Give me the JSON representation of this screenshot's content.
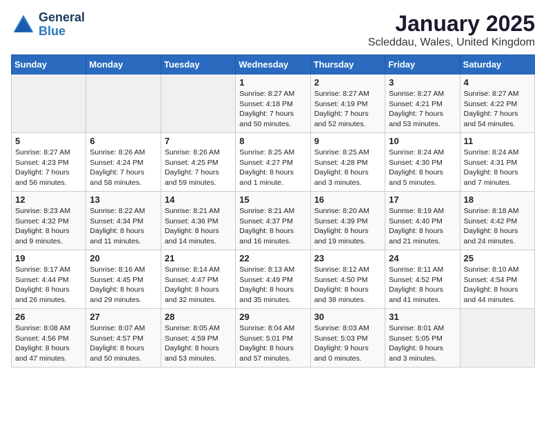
{
  "logo": {
    "line1": "General",
    "line2": "Blue"
  },
  "title": "January 2025",
  "location": "Scleddau, Wales, United Kingdom",
  "days_header": [
    "Sunday",
    "Monday",
    "Tuesday",
    "Wednesday",
    "Thursday",
    "Friday",
    "Saturday"
  ],
  "weeks": [
    [
      {
        "day": "",
        "text": ""
      },
      {
        "day": "",
        "text": ""
      },
      {
        "day": "",
        "text": ""
      },
      {
        "day": "1",
        "text": "Sunrise: 8:27 AM\nSunset: 4:18 PM\nDaylight: 7 hours\nand 50 minutes."
      },
      {
        "day": "2",
        "text": "Sunrise: 8:27 AM\nSunset: 4:19 PM\nDaylight: 7 hours\nand 52 minutes."
      },
      {
        "day": "3",
        "text": "Sunrise: 8:27 AM\nSunset: 4:21 PM\nDaylight: 7 hours\nand 53 minutes."
      },
      {
        "day": "4",
        "text": "Sunrise: 8:27 AM\nSunset: 4:22 PM\nDaylight: 7 hours\nand 54 minutes."
      }
    ],
    [
      {
        "day": "5",
        "text": "Sunrise: 8:27 AM\nSunset: 4:23 PM\nDaylight: 7 hours\nand 56 minutes."
      },
      {
        "day": "6",
        "text": "Sunrise: 8:26 AM\nSunset: 4:24 PM\nDaylight: 7 hours\nand 58 minutes."
      },
      {
        "day": "7",
        "text": "Sunrise: 8:26 AM\nSunset: 4:25 PM\nDaylight: 7 hours\nand 59 minutes."
      },
      {
        "day": "8",
        "text": "Sunrise: 8:25 AM\nSunset: 4:27 PM\nDaylight: 8 hours\nand 1 minute."
      },
      {
        "day": "9",
        "text": "Sunrise: 8:25 AM\nSunset: 4:28 PM\nDaylight: 8 hours\nand 3 minutes."
      },
      {
        "day": "10",
        "text": "Sunrise: 8:24 AM\nSunset: 4:30 PM\nDaylight: 8 hours\nand 5 minutes."
      },
      {
        "day": "11",
        "text": "Sunrise: 8:24 AM\nSunset: 4:31 PM\nDaylight: 8 hours\nand 7 minutes."
      }
    ],
    [
      {
        "day": "12",
        "text": "Sunrise: 8:23 AM\nSunset: 4:32 PM\nDaylight: 8 hours\nand 9 minutes."
      },
      {
        "day": "13",
        "text": "Sunrise: 8:22 AM\nSunset: 4:34 PM\nDaylight: 8 hours\nand 11 minutes."
      },
      {
        "day": "14",
        "text": "Sunrise: 8:21 AM\nSunset: 4:36 PM\nDaylight: 8 hours\nand 14 minutes."
      },
      {
        "day": "15",
        "text": "Sunrise: 8:21 AM\nSunset: 4:37 PM\nDaylight: 8 hours\nand 16 minutes."
      },
      {
        "day": "16",
        "text": "Sunrise: 8:20 AM\nSunset: 4:39 PM\nDaylight: 8 hours\nand 19 minutes."
      },
      {
        "day": "17",
        "text": "Sunrise: 8:19 AM\nSunset: 4:40 PM\nDaylight: 8 hours\nand 21 minutes."
      },
      {
        "day": "18",
        "text": "Sunrise: 8:18 AM\nSunset: 4:42 PM\nDaylight: 8 hours\nand 24 minutes."
      }
    ],
    [
      {
        "day": "19",
        "text": "Sunrise: 8:17 AM\nSunset: 4:44 PM\nDaylight: 8 hours\nand 26 minutes."
      },
      {
        "day": "20",
        "text": "Sunrise: 8:16 AM\nSunset: 4:45 PM\nDaylight: 8 hours\nand 29 minutes."
      },
      {
        "day": "21",
        "text": "Sunrise: 8:14 AM\nSunset: 4:47 PM\nDaylight: 8 hours\nand 32 minutes."
      },
      {
        "day": "22",
        "text": "Sunrise: 8:13 AM\nSunset: 4:49 PM\nDaylight: 8 hours\nand 35 minutes."
      },
      {
        "day": "23",
        "text": "Sunrise: 8:12 AM\nSunset: 4:50 PM\nDaylight: 8 hours\nand 38 minutes."
      },
      {
        "day": "24",
        "text": "Sunrise: 8:11 AM\nSunset: 4:52 PM\nDaylight: 8 hours\nand 41 minutes."
      },
      {
        "day": "25",
        "text": "Sunrise: 8:10 AM\nSunset: 4:54 PM\nDaylight: 8 hours\nand 44 minutes."
      }
    ],
    [
      {
        "day": "26",
        "text": "Sunrise: 8:08 AM\nSunset: 4:56 PM\nDaylight: 8 hours\nand 47 minutes."
      },
      {
        "day": "27",
        "text": "Sunrise: 8:07 AM\nSunset: 4:57 PM\nDaylight: 8 hours\nand 50 minutes."
      },
      {
        "day": "28",
        "text": "Sunrise: 8:05 AM\nSunset: 4:59 PM\nDaylight: 8 hours\nand 53 minutes."
      },
      {
        "day": "29",
        "text": "Sunrise: 8:04 AM\nSunset: 5:01 PM\nDaylight: 8 hours\nand 57 minutes."
      },
      {
        "day": "30",
        "text": "Sunrise: 8:03 AM\nSunset: 5:03 PM\nDaylight: 9 hours\nand 0 minutes."
      },
      {
        "day": "31",
        "text": "Sunrise: 8:01 AM\nSunset: 5:05 PM\nDaylight: 9 hours\nand 3 minutes."
      },
      {
        "day": "",
        "text": ""
      }
    ]
  ]
}
